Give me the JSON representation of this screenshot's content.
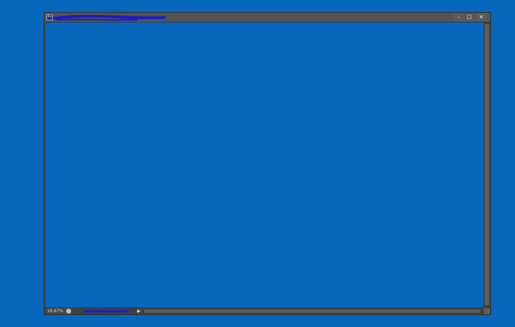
{
  "window": {
    "title_icon_text": "Ps",
    "controls": {
      "minimize": "–",
      "maximize": "☐",
      "close": "✕"
    }
  },
  "status": {
    "zoom": "16,67%",
    "arrow": "▶"
  },
  "colors": {
    "desktop": "#0767bd",
    "canvas": "#0767bd",
    "chrome": "#4a4a4a",
    "redaction": "#1a1ad0"
  },
  "icons": [
    "app-icon",
    "minimize-icon",
    "maximize-icon",
    "close-icon",
    "status-info-icon",
    "expand-arrow-icon"
  ]
}
